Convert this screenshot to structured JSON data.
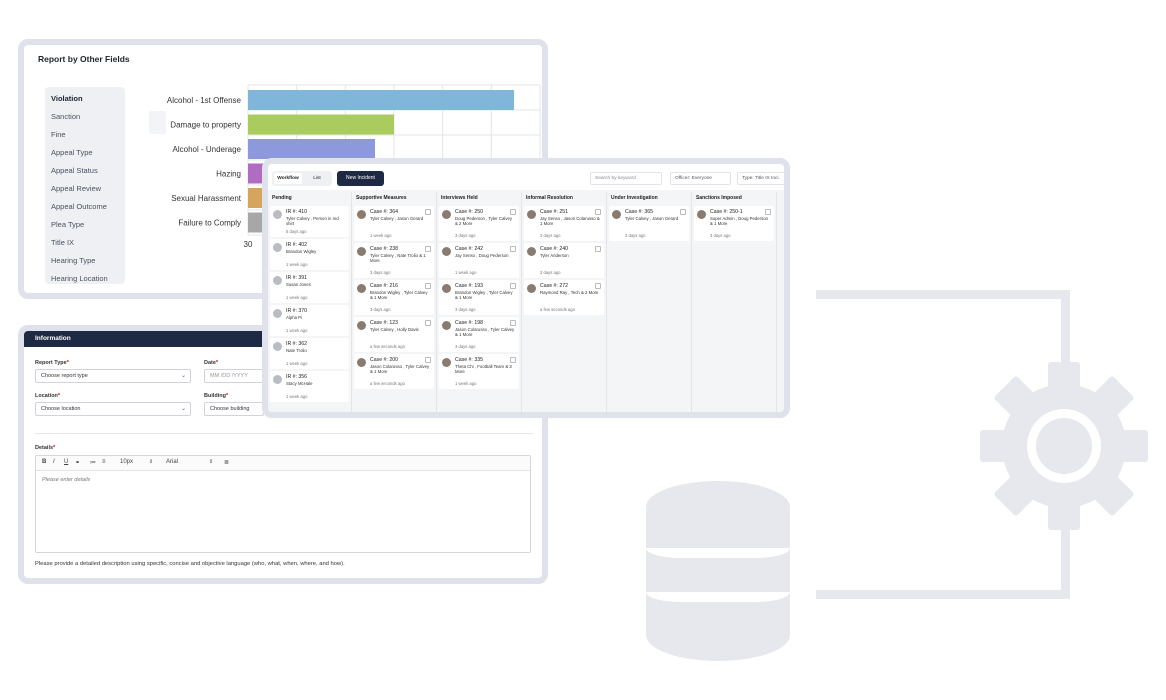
{
  "report": {
    "title": "Report by Other Fields",
    "fields": [
      "Violation",
      "Sanction",
      "Fine",
      "Appeal Type",
      "Appeal Status",
      "Appeal Review",
      "Appeal Outcome",
      "Plea Type",
      "Title IX",
      "Hearing Type",
      "Hearing Location"
    ],
    "active_field": "Violation"
  },
  "chart_data": {
    "type": "bar",
    "orientation": "horizontal",
    "categories": [
      "Alcohol - 1st Offense",
      "Damage to property",
      "Alcohol - Underage",
      "Hazing",
      "Sexual Harassment",
      "Failure to Comply"
    ],
    "colors": [
      "#7fb6d9",
      "#aacb5e",
      "#8e98dd",
      "#b06cc0",
      "#d5a55e",
      "#a7a7a7"
    ],
    "x_tick_first": "30",
    "grid": true
  },
  "info": {
    "header": "Information",
    "report_type_label": "Report Type",
    "report_type_value": "Choose report type",
    "date_label": "Date",
    "date_placeholder": "MM /DD /YYYY",
    "location_label": "Location",
    "location_value": "Choose location",
    "building_label": "Building",
    "building_value": "Choose building",
    "details_label": "Details",
    "required_mark": "*",
    "toolbar": {
      "bold": "B",
      "italic": "I",
      "underline": "U",
      "font_size": "10px",
      "font": "Arial"
    },
    "details_placeholder": "Please enter details",
    "helper": "Please provide a detailed description using specific, concise and objective language (who, what, when, where, and how)."
  },
  "workflow": {
    "tab_workflow": "Workflow",
    "tab_list": "List",
    "new_incident": "New Incident",
    "search_placeholder": "Search by keyword",
    "officer": "Officer:  Everyone",
    "type": "Type:  Title IX Inci",
    "columns": [
      {
        "title": "Pending",
        "cards": [
          {
            "case": "IR #: 410",
            "names": "Tyler Calvey , Person in red shirt",
            "time": "5 days ago"
          },
          {
            "case": "IR #: 402",
            "names": "Brandon Wigley",
            "time": "1 week ago"
          },
          {
            "case": "IR #: 391",
            "names": "Susan Jones",
            "time": "1 week ago"
          },
          {
            "case": "IR #: 370",
            "names": "Alpha Pi",
            "time": "1 week ago"
          },
          {
            "case": "IR #: 362",
            "names": "Nate Trolio",
            "time": "1 week ago"
          },
          {
            "case": "IR #: 356",
            "names": "Stacy McHale",
            "time": "1 week ago"
          }
        ]
      },
      {
        "title": "Supportive Measures",
        "cards": [
          {
            "case": "Case #: 364",
            "names": "Tyler Calvey , Jason Gerard",
            "time": "1 week ago"
          },
          {
            "case": "Case #: 238",
            "names": "Tyler Calvey , Nate Trolio & 1 More",
            "time": "3 days ago"
          },
          {
            "case": "Case #: 216",
            "names": "Brandon Wigley , Tyler Calvey & 1 More",
            "time": "3 days ago"
          },
          {
            "case": "Case #: 123",
            "names": "Tyler Calvey , Holly Davis",
            "time": "a few seconds ago"
          },
          {
            "case": "Case #: 200",
            "names": "Jason Colarusso , Tyler Calvey & 1 More",
            "time": "a few seconds ago"
          }
        ]
      },
      {
        "title": "Interviews Held",
        "cards": [
          {
            "case": "Case #: 250",
            "names": "Doug Pederson , Tyler Calvey & 2 More",
            "time": "3 days ago"
          },
          {
            "case": "Case #: 242",
            "names": "Jay Senso , Doug Pederson",
            "time": "1 week ago"
          },
          {
            "case": "Case #: 193",
            "names": "Brandon Wigley , Tyler Calvey & 1 More",
            "time": "3 days ago"
          },
          {
            "case": "Case #: 198",
            "names": "Jason Colarusso , Tyler Calvey & 1 More",
            "time": "3 days ago"
          },
          {
            "case": "Case #: 335",
            "names": "Theta Chi , Football Team & 3 More",
            "time": "1 week ago"
          }
        ]
      },
      {
        "title": "Informal Resolution",
        "cards": [
          {
            "case": "Case #: 251",
            "names": "Jay Senso , Jason Colarusso & 1 More",
            "time": "3 days ago"
          },
          {
            "case": "Case #: 240",
            "names": "Tyler Anderson",
            "time": "3 days ago"
          },
          {
            "case": "Case #: 272",
            "names": "Raymond Ray , Tech & 2 More",
            "time": "a few seconds ago"
          }
        ]
      },
      {
        "title": "Under Investigation",
        "cards": [
          {
            "case": "Case #: 365",
            "names": "Tyler Calvey , Jason Gerard",
            "time": "3 days ago"
          }
        ]
      },
      {
        "title": "Sanctions Imposed",
        "cards": [
          {
            "case": "Case #: 250-1",
            "names": "Super Admin , Doug Pederson & 1 More",
            "time": "3 days ago"
          }
        ]
      }
    ]
  }
}
